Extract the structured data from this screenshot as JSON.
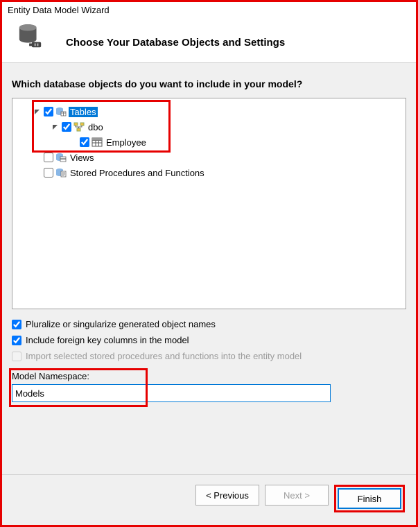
{
  "window": {
    "title": "Entity Data Model Wizard"
  },
  "header": {
    "title": "Choose Your Database Objects and Settings"
  },
  "question": "Which database objects do you want to include in your model?",
  "tree": {
    "tables": {
      "label": "Tables",
      "checked": true,
      "expanded": true,
      "selected": true
    },
    "dbo": {
      "label": "dbo",
      "checked": true,
      "expanded": true
    },
    "employee": {
      "label": "Employee",
      "checked": true
    },
    "views": {
      "label": "Views",
      "checked": false
    },
    "sprocs": {
      "label": "Stored Procedures and Functions",
      "checked": false
    }
  },
  "options": {
    "pluralize": {
      "label": "Pluralize or singularize generated object names",
      "checked": true
    },
    "foreignKeys": {
      "label": "Include foreign key columns in the model",
      "checked": true
    },
    "importSprocs": {
      "label": "Import selected stored procedures and functions into the entity model",
      "checked": false,
      "disabled": true
    }
  },
  "namespace": {
    "label": "Model Namespace:",
    "value": "Models"
  },
  "buttons": {
    "previous": "< Previous",
    "next": "Next >",
    "finish": "Finish"
  }
}
